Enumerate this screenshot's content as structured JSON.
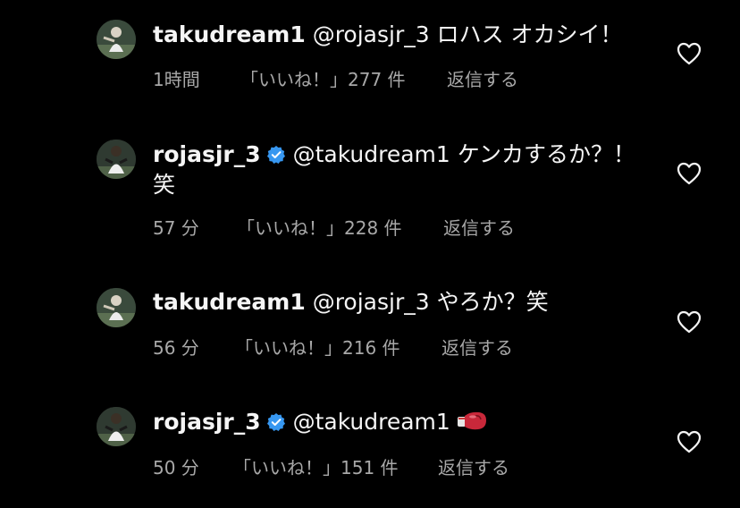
{
  "colors": {
    "background": "#000000",
    "primary_text": "#f5f5f5",
    "secondary_text": "#a8a8a8",
    "verified_badge": "#3797f0"
  },
  "comments": [
    {
      "username": "takudream1",
      "verified": false,
      "mention": "@rojasjr_3",
      "text": " ロハス オカシイ！",
      "time": "1時間",
      "likes": "「いいね！」277 件",
      "reply": "返信する",
      "avatar_icon": "avatar-takudream1-icon",
      "like_icon": "heart-outline-icon"
    },
    {
      "username": "rojasjr_3",
      "verified": true,
      "mention": "@takudream1",
      "text": " ケンカするか？！笑",
      "time": "57 分",
      "likes": "「いいね！」228 件",
      "reply": "返信する",
      "avatar_icon": "avatar-rojasjr_3-icon",
      "like_icon": "heart-outline-icon"
    },
    {
      "username": "takudream1",
      "verified": false,
      "mention": "@rojasjr_3",
      "text": " やろか？笑",
      "time": "56 分",
      "likes": "「いいね！」216 件",
      "reply": "返信する",
      "avatar_icon": "avatar-takudream1-icon",
      "like_icon": "heart-outline-icon"
    },
    {
      "username": "rojasjr_3",
      "verified": true,
      "mention": "@takudream1",
      "text": "",
      "emoji": "boxing-glove-icon",
      "time": "50 分",
      "likes": "「いいね！」151 件",
      "reply": "返信する",
      "avatar_icon": "avatar-rojasjr_3-icon",
      "like_icon": "heart-outline-icon"
    }
  ]
}
